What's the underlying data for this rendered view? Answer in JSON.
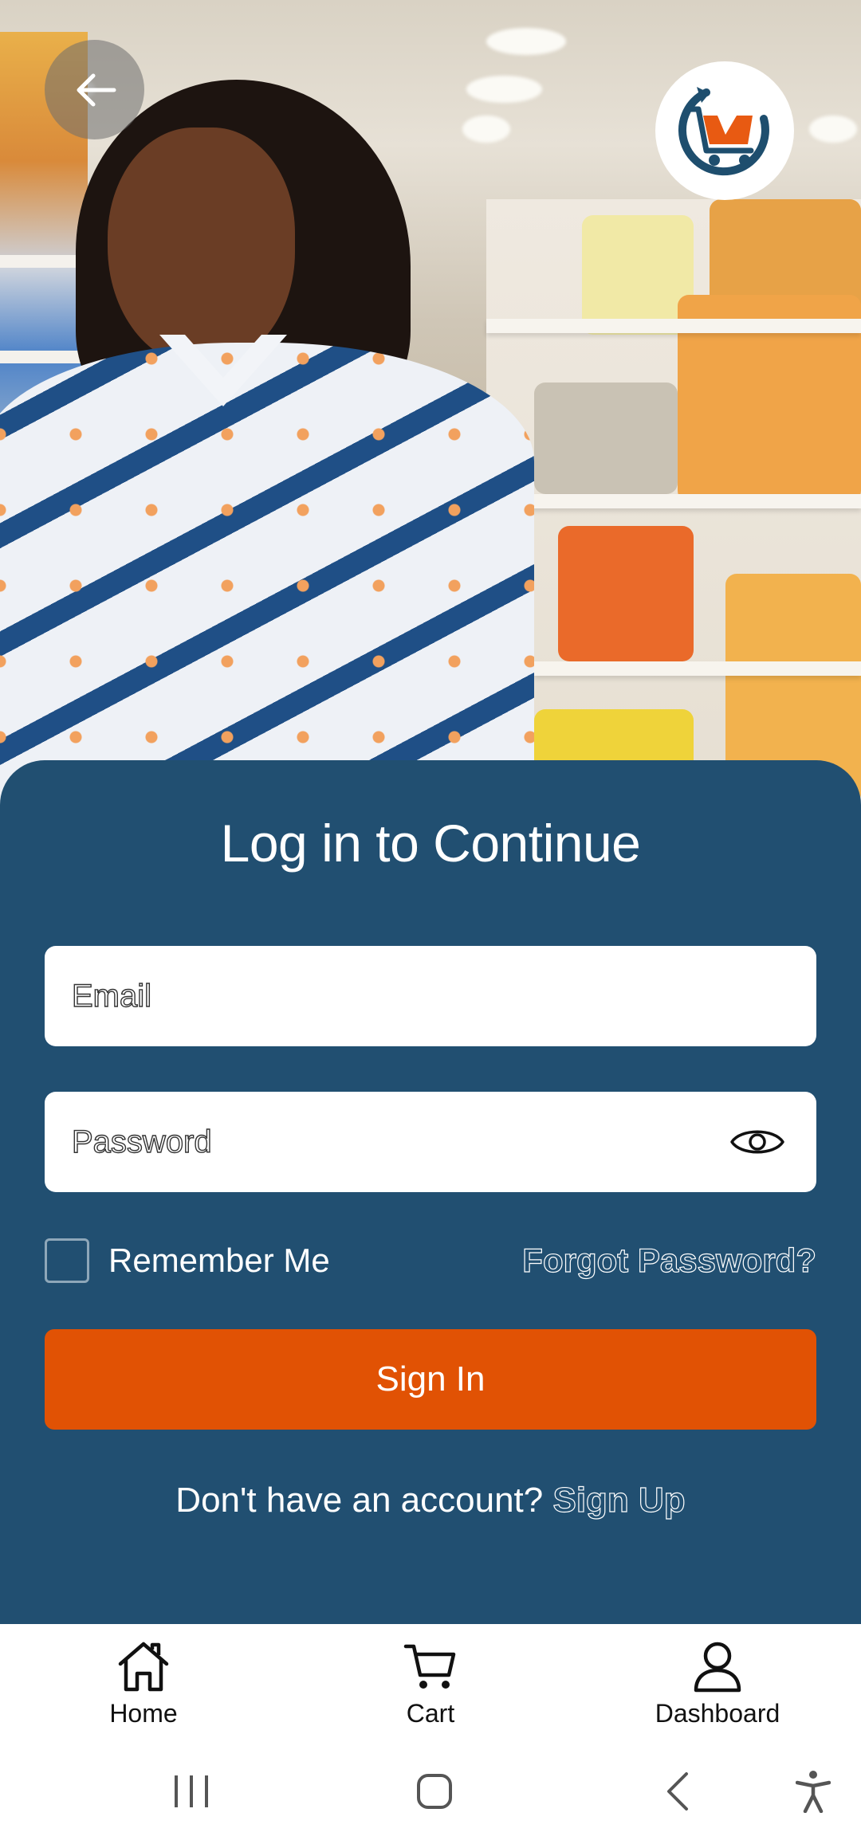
{
  "hero": {
    "image": "woman-in-grocery-store-photo"
  },
  "header": {
    "back_icon": "arrow-left-icon",
    "logo": "shopping-cart-logo"
  },
  "login": {
    "title": "Log in to Continue",
    "email_placeholder": "Email",
    "email_value": "",
    "password_placeholder": "Password",
    "password_value": "",
    "password_toggle_icon": "eye-icon",
    "remember_me_label": "Remember Me",
    "remember_me_checked": false,
    "forgot_password_label": "Forgot Password?",
    "sign_in_label": "Sign In",
    "no_account_text": "Don't have an account?",
    "sign_up_label": "Sign Up"
  },
  "tab_bar": {
    "items": [
      {
        "label": "Home",
        "icon": "home-icon"
      },
      {
        "label": "Cart",
        "icon": "cart-icon"
      },
      {
        "label": "Dashboard",
        "icon": "user-icon"
      }
    ]
  },
  "system_nav": {
    "recents_icon": "recents-icon",
    "home_icon": "home-circle-icon",
    "back_icon": "chevron-left-icon",
    "accessibility_icon": "accessibility-icon"
  },
  "colors": {
    "card_background": "#214f71",
    "accent": "#e15204",
    "logo_ring": "#1e4e6e",
    "logo_cart": "#e85a12"
  }
}
